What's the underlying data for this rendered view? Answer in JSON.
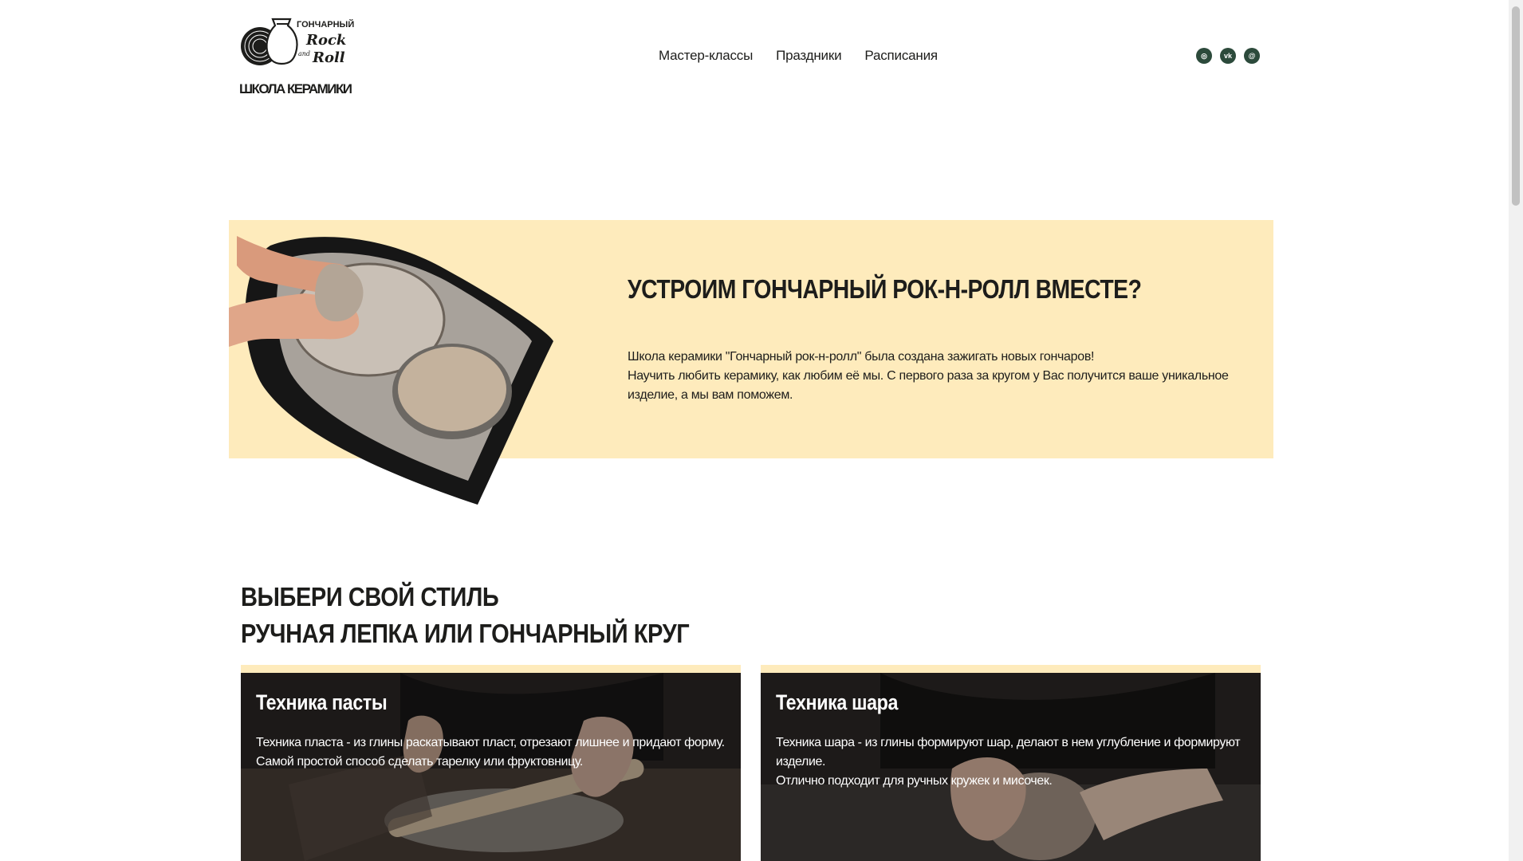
{
  "header": {
    "logo": {
      "line1": "ГОНЧАРНЫЙ",
      "line2": "Rock",
      "line3": "and",
      "line4": "Roll",
      "line5": "ШКОЛА КЕРАМИКИ"
    },
    "nav": [
      {
        "label": "Мастер-классы"
      },
      {
        "label": "Праздники"
      },
      {
        "label": "Расписания"
      }
    ],
    "socials": [
      {
        "icon": "instagram-icon",
        "glyph": "◎"
      },
      {
        "icon": "vk-icon",
        "glyph": "vk"
      },
      {
        "icon": "email-icon",
        "glyph": "@"
      }
    ]
  },
  "hero": {
    "title": "УСТРОИМ ГОНЧАРНЫЙ РОК-Н-РОЛЛ ВМЕСТЕ?",
    "p1": "Школа керамики \"Гончарный рок-н-ролл\" была создана зажигать новых гончаров!",
    "p2": "Научить любить керамику, как любим её мы. С первого раза за кругом у Вас получится ваше уникальное изделие, а мы вам поможем."
  },
  "section": {
    "title_line1": "ВЫБЕРИ СВОЙ СТИЛЬ",
    "title_line2": "РУЧНАЯ ЛЕПКА ИЛИ ГОНЧАРНЫЙ КРУГ"
  },
  "cards": [
    {
      "title": "Техника пасты",
      "p1": "Техника пласта - из глины раскатывают пласт, отрезают лишнее и придают форму.",
      "p2": "Самой простой способ сделать тарелку или фруктовницу."
    },
    {
      "title": "Техника шара",
      "p1": "Техника шара - из глины формируют шар, делают в нем углубление и формируют изделие.",
      "p2": "Отлично подходит для ручных кружек и мисочек."
    }
  ],
  "colors": {
    "accent_bg": "#feebbc",
    "social": "#2c4a3b",
    "text": "#1d1d1b"
  }
}
